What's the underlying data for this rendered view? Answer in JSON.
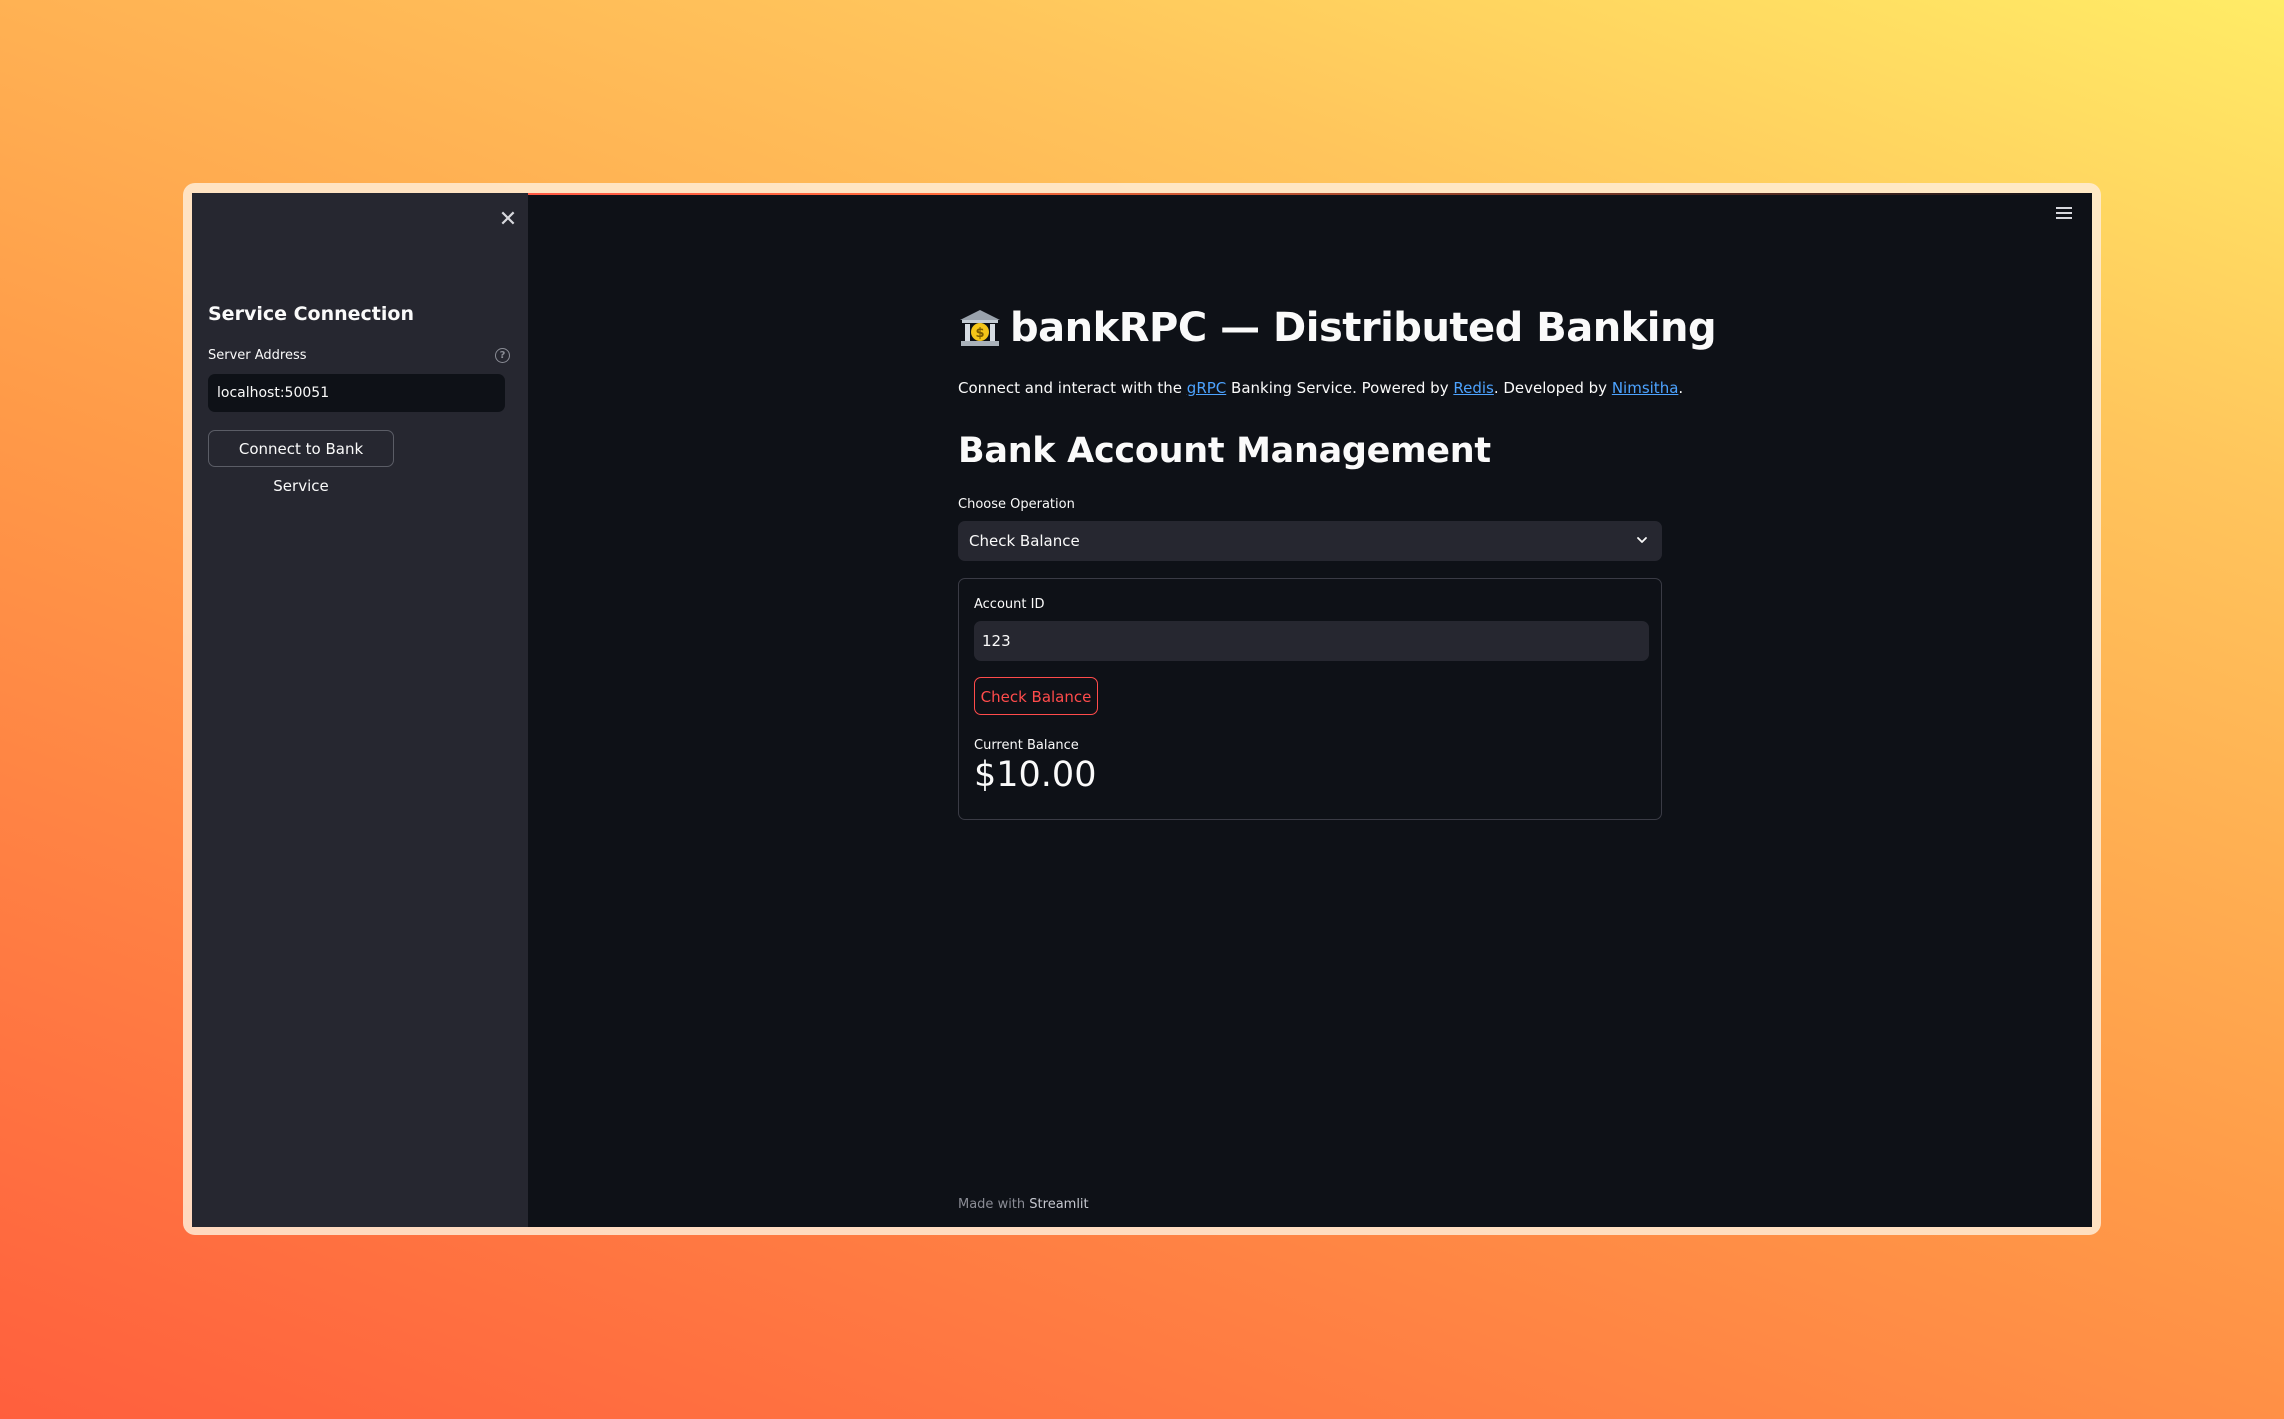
{
  "sidebar": {
    "close_icon": "close-icon",
    "title": "Service Connection",
    "server_label": "Server Address",
    "help_icon": "help-circle-icon",
    "server_value": "localhost:50051",
    "connect_button": "Connect to Bank Service"
  },
  "header": {
    "menu_icon": "hamburger-menu-icon"
  },
  "main": {
    "title_icon": "bank-icon",
    "title": "bankRPC — Distributed Banking",
    "subtitle": {
      "part1": "Connect and interact with the ",
      "link1": "gRPC",
      "part2": " Banking Service. Powered by ",
      "link2": "Redis",
      "part3": ". Developed by ",
      "link3": "Nimsitha",
      "part4": "."
    },
    "section_title": "Bank Account Management",
    "operation_label": "Choose Operation",
    "operation_selected": "Check Balance",
    "form": {
      "account_label": "Account ID",
      "account_value": "123",
      "submit_button": "Check Balance",
      "metric_label": "Current Balance",
      "metric_value": "$10.00"
    },
    "footer": {
      "prefix": "Made with ",
      "brand": "Streamlit"
    }
  },
  "colors": {
    "background": "#0e1117",
    "sidebar": "#262730",
    "accent": "#ff4b4b",
    "link": "#4da3ff"
  }
}
